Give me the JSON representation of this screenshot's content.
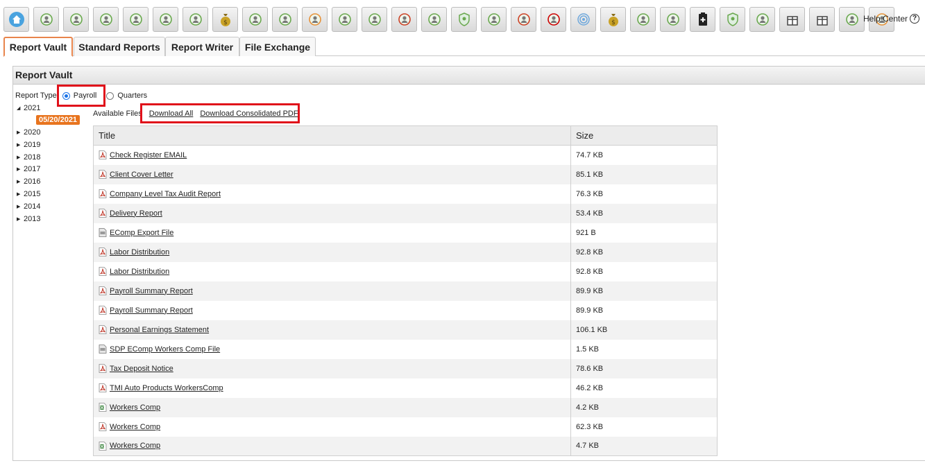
{
  "toolbar": {
    "buttons": [
      {
        "name": "home-icon",
        "color": "#4aa3df"
      },
      {
        "name": "payroll-icon",
        "color": "#6aa84f"
      },
      {
        "name": "employees-settings-icon",
        "color": "#6aa84f"
      },
      {
        "name": "timecard-icon",
        "color": "#6aa84f"
      },
      {
        "name": "group-icon",
        "color": "#6aa84f"
      },
      {
        "name": "org-chart-icon",
        "color": "#6aa84f"
      },
      {
        "name": "document-edit-icon",
        "color": "#6aa84f"
      },
      {
        "name": "money-bag-icon",
        "color": "#c9a227"
      },
      {
        "name": "search-user-icon",
        "color": "#6aa84f"
      },
      {
        "name": "target-icon",
        "color": "#6aa84f"
      },
      {
        "name": "compass-icon",
        "color": "#e69138"
      },
      {
        "name": "chart-user-icon",
        "color": "#6aa84f"
      },
      {
        "name": "settings-gear-icon",
        "color": "#6aa84f"
      },
      {
        "name": "transfer-user-icon",
        "color": "#cc4125"
      },
      {
        "name": "promotion-icon",
        "color": "#6aa84f"
      },
      {
        "name": "shield-user-icon",
        "color": "#6aa84f"
      },
      {
        "name": "network-user-icon",
        "color": "#6aa84f"
      },
      {
        "name": "exchange-user-icon",
        "color": "#cc4125"
      },
      {
        "name": "remove-user-icon",
        "color": "#cc0000"
      },
      {
        "name": "fingerprint-icon",
        "color": "#6fa8dc"
      },
      {
        "name": "dollar-bag-icon",
        "color": "#c9a227"
      },
      {
        "name": "user-upgrade-icon",
        "color": "#6aa84f"
      },
      {
        "name": "team-grid-icon",
        "color": "#6aa84f"
      },
      {
        "name": "clipboard-icon",
        "color": "#222222"
      },
      {
        "name": "badge-shield-icon",
        "color": "#6aa84f"
      },
      {
        "name": "user-search-icon",
        "color": "#6aa84f"
      },
      {
        "name": "gift-icon",
        "color": "#444444"
      },
      {
        "name": "file-list-icon",
        "color": "#444444"
      },
      {
        "name": "team-board-icon",
        "color": "#6aa84f"
      },
      {
        "name": "certificate-icon",
        "color": "#e69138"
      }
    ],
    "help_label": "Help Center",
    "help_glyph": "?"
  },
  "tabs": [
    {
      "label": "Report Vault",
      "active": true
    },
    {
      "label": "Standard Reports",
      "active": false
    },
    {
      "label": "Report Writer",
      "active": false
    },
    {
      "label": "File Exchange",
      "active": false
    }
  ],
  "panel": {
    "title": "Report Vault",
    "report_type_label": "Report Type",
    "report_type_options": [
      {
        "label": "Payroll",
        "checked": true
      },
      {
        "label": "Quarters",
        "checked": false
      }
    ]
  },
  "tree": {
    "expanded_year": "2021",
    "selected_date": "05/20/2021",
    "years": [
      "2020",
      "2019",
      "2018",
      "2017",
      "2016",
      "2015",
      "2014",
      "2013"
    ]
  },
  "files": {
    "available_label": "Available Files",
    "download_all": "Download All",
    "download_pdf": "Download Consolidated PDF",
    "columns": [
      "Title",
      "Size"
    ],
    "rows": [
      {
        "title": "Check Register EMAIL",
        "size": "74.7 KB",
        "type": "pdf"
      },
      {
        "title": "Client Cover Letter",
        "size": "85.1 KB",
        "type": "pdf"
      },
      {
        "title": "Company Level Tax Audit Report",
        "size": "76.3 KB",
        "type": "pdf"
      },
      {
        "title": "Delivery Report",
        "size": "53.4 KB",
        "type": "pdf"
      },
      {
        "title": "EComp Export File",
        "size": "921 B",
        "type": "generic"
      },
      {
        "title": "Labor Distribution",
        "size": "92.8 KB",
        "type": "pdf"
      },
      {
        "title": "Labor Distribution",
        "size": "92.8 KB",
        "type": "pdf"
      },
      {
        "title": "Payroll Summary Report",
        "size": "89.9 KB",
        "type": "pdf"
      },
      {
        "title": "Payroll Summary Report",
        "size": "89.9 KB",
        "type": "pdf"
      },
      {
        "title": "Personal Earnings Statement",
        "size": "106.1 KB",
        "type": "pdf"
      },
      {
        "title": "SDP EComp Workers Comp File",
        "size": "1.5 KB",
        "type": "generic"
      },
      {
        "title": "Tax Deposit Notice",
        "size": "78.6 KB",
        "type": "pdf"
      },
      {
        "title": "TMI Auto Products WorkersComp",
        "size": "46.2 KB",
        "type": "pdf"
      },
      {
        "title": "Workers Comp",
        "size": "4.2 KB",
        "type": "excel"
      },
      {
        "title": "Workers Comp",
        "size": "62.3 KB",
        "type": "pdf"
      },
      {
        "title": "Workers Comp",
        "size": "4.7 KB",
        "type": "excel"
      }
    ]
  },
  "colors": {
    "highlight": "#e0101a",
    "active_tab_border": "#e8844b",
    "date_badge": "#e8741e",
    "pdf_icon": "#c0392b",
    "excel_icon": "#2e7d32"
  }
}
